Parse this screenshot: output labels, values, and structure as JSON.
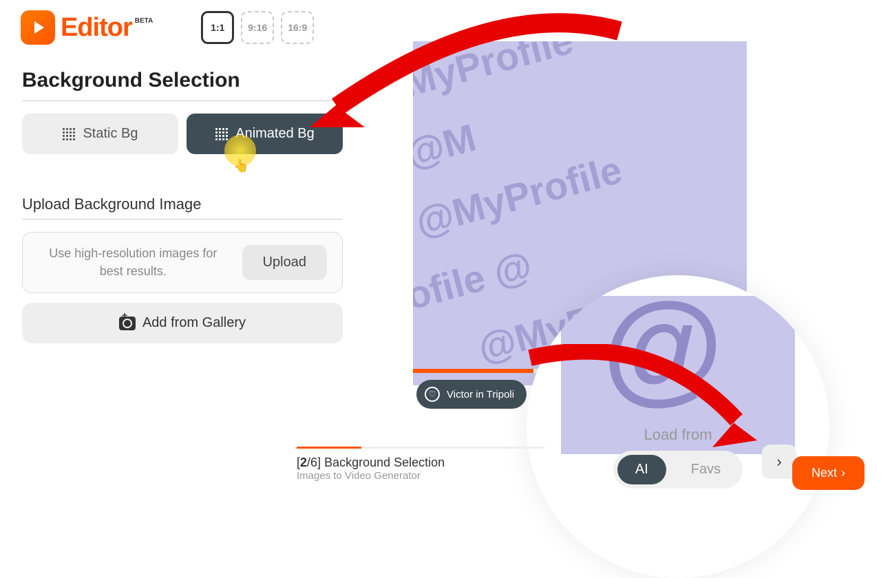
{
  "header": {
    "brand": "Editor",
    "badge": "BETA",
    "aspects": [
      "1:1",
      "9:16",
      "16:9"
    ],
    "active_aspect": 0
  },
  "bg_section": {
    "title": "Background Selection",
    "static_label": "Static Bg",
    "animated_label": "Animated Bg"
  },
  "upload": {
    "title": "Upload Background Image",
    "hint": "Use high-resolution images for best results.",
    "button": "Upload",
    "gallery": "Add from Gallery"
  },
  "caption": {
    "text": "Victor in Tripoli"
  },
  "zoom": {
    "load_label": "Load from",
    "ai": "AI",
    "favs": "Favs"
  },
  "footer": {
    "step_current": "2",
    "step_total": "6",
    "title": "Background Selection",
    "subtitle": "Images to Video Generator",
    "next": "Next"
  }
}
